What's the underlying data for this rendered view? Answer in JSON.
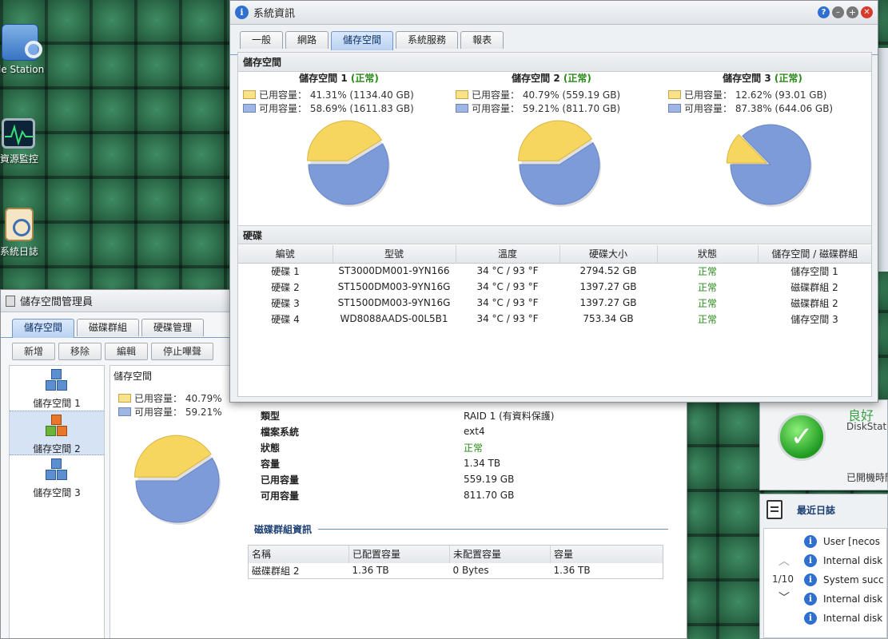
{
  "desktop": {
    "icons": [
      {
        "label": "le Station"
      },
      {
        "label": "資源監控"
      },
      {
        "label": "系統日誌"
      }
    ]
  },
  "sysinfo": {
    "title": "系統資訊",
    "tabs": [
      {
        "label": "一般"
      },
      {
        "label": "網路"
      },
      {
        "label": "儲存空間"
      },
      {
        "label": "系統服務"
      },
      {
        "label": "報表"
      }
    ],
    "storage_header": "儲存空間",
    "volumes": [
      {
        "name": "儲存空間 1",
        "status": "(正常)",
        "used_label": "已用容量：",
        "used": "41.31% (1134.40 GB)",
        "free_label": "可用容量：",
        "free": "58.69% (1611.83 GB)",
        "used_pct": 41.31
      },
      {
        "name": "儲存空間 2",
        "status": "(正常)",
        "used_label": "已用容量：",
        "used": "40.79% (559.19 GB)",
        "free_label": "可用容量：",
        "free": "59.21% (811.70 GB)",
        "used_pct": 40.79
      },
      {
        "name": "儲存空間 3",
        "status": "(正常)",
        "used_label": "已用容量：",
        "used": "12.62% (93.01 GB)",
        "free_label": "可用容量：",
        "free": "87.38% (644.06 GB)",
        "used_pct": 12.62
      }
    ],
    "disk_header": "硬碟",
    "columns": [
      "編號",
      "型號",
      "溫度",
      "硬碟大小",
      "狀態",
      "儲存空間 / 磁碟群組"
    ],
    "disks": [
      [
        "硬碟 1",
        "ST3000DM001-9YN166",
        "34 °C / 93 °F",
        "2794.52 GB",
        "正常",
        "儲存空間 1"
      ],
      [
        "硬碟 2",
        "ST1500DM003-9YN16G",
        "34 °C / 93 °F",
        "1397.27 GB",
        "正常",
        "磁碟群組 2"
      ],
      [
        "硬碟 3",
        "ST1500DM003-9YN16G",
        "34 °C / 93 °F",
        "1397.27 GB",
        "正常",
        "磁碟群組 2"
      ],
      [
        "硬碟 4",
        "WD8088AADS-00L5B1",
        "34 °C / 93 °F",
        "753.34 GB",
        "正常",
        "儲存空間 3"
      ]
    ]
  },
  "storage_mgr": {
    "title": "儲存空間管理員",
    "tabs": [
      {
        "label": "儲存空間"
      },
      {
        "label": "磁碟群組"
      },
      {
        "label": "硬碟管理"
      }
    ],
    "buttons": [
      {
        "label": "新增"
      },
      {
        "label": "移除"
      },
      {
        "label": "編輯"
      },
      {
        "label": "停止嗶聲"
      }
    ],
    "list": [
      {
        "label": "儲存空間 1"
      },
      {
        "label": "儲存空間 2"
      },
      {
        "label": "儲存空間 3"
      }
    ],
    "detail_title": "儲存空間",
    "used_label": "已用容量：",
    "used_value": "40.79%",
    "free_label": "可用容量：",
    "free_value": "59.21%",
    "used_pct": 40.79,
    "props": [
      {
        "k": "類型",
        "v": "RAID 1 (有資料保護)"
      },
      {
        "k": "檔案系統",
        "v": "ext4"
      },
      {
        "k": "狀態",
        "v": "正常"
      },
      {
        "k": "容量",
        "v": "1.34 TB"
      },
      {
        "k": "已用容量",
        "v": "559.19 GB"
      },
      {
        "k": "可用容量",
        "v": "811.70 GB"
      }
    ],
    "group_section": "磁碟群組資訊",
    "group_cols": [
      "名稱",
      "已配置容量",
      "未配置容量",
      "容量"
    ],
    "group_row": [
      "磁碟群組 2",
      "1.36 TB",
      "0 Bytes",
      "1.36 TB"
    ]
  },
  "health": {
    "status": "良好",
    "label": "DiskStat",
    "uptime": "已開機時間"
  },
  "logs": {
    "title": "最近日誌",
    "page": "1/10",
    "items": [
      {
        "text": "User [necos"
      },
      {
        "text": "Internal disk"
      },
      {
        "text": "System succ"
      },
      {
        "text": "Internal disk"
      },
      {
        "text": "Internal disk"
      }
    ]
  },
  "colors": {
    "used": "#f6d65e",
    "free": "#7e9bd9",
    "ok": "#2a8a1a",
    "accent": "#1b5bbd"
  }
}
